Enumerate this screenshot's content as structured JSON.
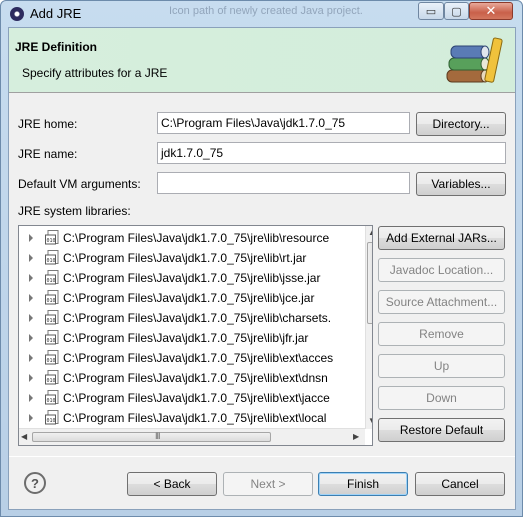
{
  "window": {
    "title": "Add JRE",
    "background_text": "Icon path of newly created Java project.",
    "controls": {
      "minimize": "▭",
      "maximize": "▢",
      "close": "✕"
    }
  },
  "banner": {
    "title": "JRE Definition",
    "description": "Specify attributes for a JRE",
    "icon": "jre-books-icon"
  },
  "form": {
    "jre_home_label": "JRE home:",
    "jre_home_value": "C:\\Program Files\\Java\\jdk1.7.0_75",
    "directory_button": "Directory...",
    "jre_name_label": "JRE name:",
    "jre_name_value": "jdk1.7.0_75",
    "vm_args_label": "Default VM arguments:",
    "vm_args_value": "",
    "variables_button": "Variables...",
    "libraries_label": "JRE system libraries:"
  },
  "libraries": [
    "C:\\Program Files\\Java\\jdk1.7.0_75\\jre\\lib\\resource",
    "C:\\Program Files\\Java\\jdk1.7.0_75\\jre\\lib\\rt.jar",
    "C:\\Program Files\\Java\\jdk1.7.0_75\\jre\\lib\\jsse.jar",
    "C:\\Program Files\\Java\\jdk1.7.0_75\\jre\\lib\\jce.jar",
    "C:\\Program Files\\Java\\jdk1.7.0_75\\jre\\lib\\charsets.",
    "C:\\Program Files\\Java\\jdk1.7.0_75\\jre\\lib\\jfr.jar",
    "C:\\Program Files\\Java\\jdk1.7.0_75\\jre\\lib\\ext\\acces",
    "C:\\Program Files\\Java\\jdk1.7.0_75\\jre\\lib\\ext\\dnsn",
    "C:\\Program Files\\Java\\jdk1.7.0_75\\jre\\lib\\ext\\jacce",
    "C:\\Program Files\\Java\\jdk1.7.0_75\\jre\\lib\\ext\\local"
  ],
  "library_buttons": {
    "add_external": "Add External JARs...",
    "javadoc": "Javadoc Location...",
    "source": "Source Attachment...",
    "remove": "Remove",
    "up": "Up",
    "down": "Down",
    "restore": "Restore Default"
  },
  "footer": {
    "help": "?",
    "back": "< Back",
    "next": "Next >",
    "finish": "Finish",
    "cancel": "Cancel"
  },
  "scroll": {
    "up": "▲",
    "down": "▼",
    "left": "◀",
    "right": "▶",
    "grip": "III"
  }
}
